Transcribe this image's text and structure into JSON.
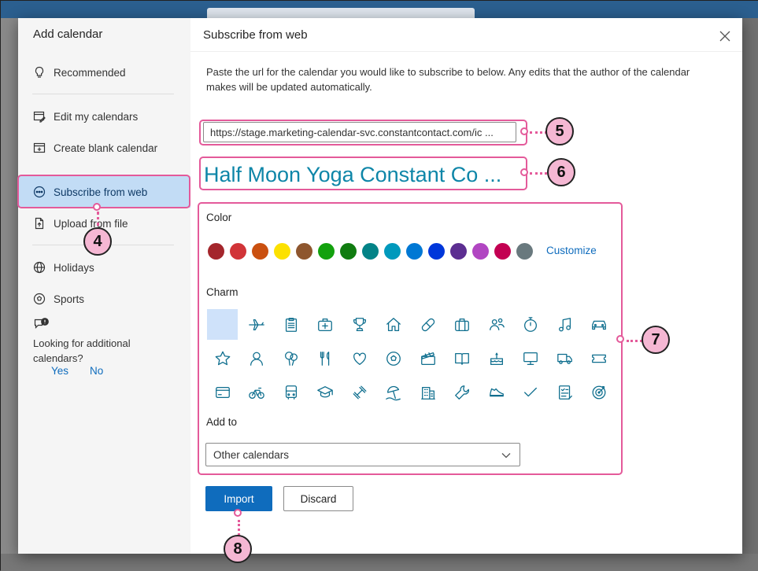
{
  "sidebar": {
    "title": "Add calendar",
    "items": [
      {
        "label": "Recommended",
        "icon": "lightbulb-icon"
      },
      {
        "label": "Edit my calendars",
        "icon": "edit-calendar-icon"
      },
      {
        "label": "Create blank calendar",
        "icon": "calendar-add-icon"
      },
      {
        "label": "Subscribe from web",
        "icon": "web-subscribe-icon",
        "active": true
      },
      {
        "label": "Upload from file",
        "icon": "file-upload-icon"
      },
      {
        "label": "Holidays",
        "icon": "globe-icon"
      },
      {
        "label": "Sports",
        "icon": "sports-ball-icon"
      }
    ],
    "question": "Looking for additional calendars?",
    "yes": "Yes",
    "no": "No"
  },
  "main": {
    "title": "Subscribe from web",
    "description": "Paste the url for the calendar you would like to subscribe to below. Any edits that the author of the calendar makes will be updated automatically.",
    "url_value": "https://stage.marketing-calendar-svc.constantcontact.com/ic ...",
    "calendar_name": "Half Moon Yoga Constant Co  ...",
    "color_label": "Color",
    "colors": [
      "#a4262c",
      "#d13438",
      "#ca5010",
      "#fce100",
      "#8e562e",
      "#13a10e",
      "#107c10",
      "#038387",
      "#0099bc",
      "#0078d4",
      "#0037da",
      "#5c2e91",
      "#b146c2",
      "#c30052",
      "#69797e"
    ],
    "customize_label": "Customize",
    "charm_label": "Charm",
    "charms": [
      "none",
      "airplane",
      "clipboard",
      "medical-kit",
      "trophy",
      "home",
      "pill",
      "briefcase",
      "people",
      "stopwatch",
      "music",
      "car",
      "star",
      "person",
      "balloons",
      "fork-knife",
      "heart",
      "soccer-ball",
      "clapperboard",
      "book",
      "cake",
      "monitor",
      "truck",
      "ticket",
      "credit-card",
      "bicycle",
      "bus",
      "graduation-cap",
      "dumbbell",
      "beach",
      "building",
      "wrench",
      "running-shoe",
      "checkmark",
      "task-list",
      "target"
    ],
    "add_to_label": "Add to",
    "add_to_value": "Other calendars",
    "import_label": "Import",
    "discard_label": "Discard"
  },
  "annotations": {
    "b4": "4",
    "b5": "5",
    "b6": "6",
    "b7": "7",
    "b8": "8"
  }
}
